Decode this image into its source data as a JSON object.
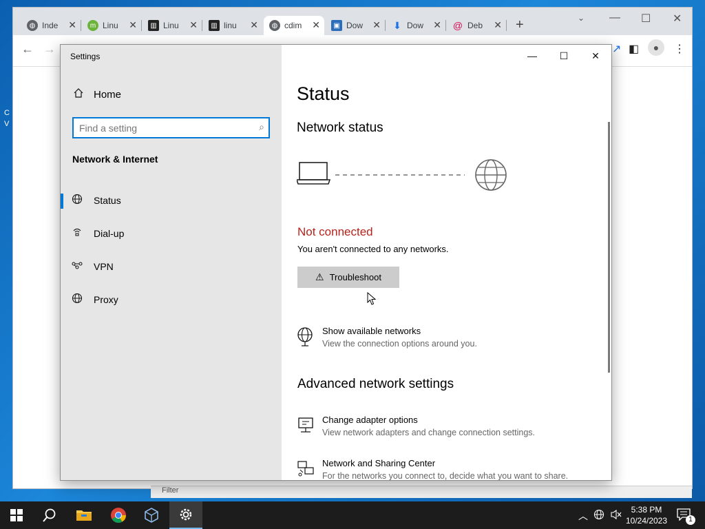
{
  "browser": {
    "tabs": [
      {
        "label": "Inde",
        "favicon": "globe-icon",
        "color": "#5f6368"
      },
      {
        "label": "Linu",
        "favicon": "mint-icon",
        "color": "#6bb33b"
      },
      {
        "label": "Linu",
        "favicon": "archive-icon",
        "color": "#222222"
      },
      {
        "label": "linu",
        "favicon": "archive-icon",
        "color": "#222222"
      },
      {
        "label": "cdim",
        "favicon": "globe-icon",
        "color": "#5f6368"
      },
      {
        "label": "Dow",
        "favicon": "image-icon",
        "color": "#2a6ebb"
      },
      {
        "label": "Dow",
        "favicon": "download-icon",
        "color": "#1a73e8"
      },
      {
        "label": "Deb",
        "favicon": "debian-icon",
        "color": "#d70a53"
      }
    ],
    "bottom_bar_text": "Filter"
  },
  "settings": {
    "window_title": "Settings",
    "nav": {
      "home_label": "Home",
      "search_placeholder": "Find a setting",
      "section_title": "Network & Internet",
      "items": [
        {
          "label": "Status",
          "icon": "status-globe-icon",
          "selected": true
        },
        {
          "label": "Dial-up",
          "icon": "dialup-icon",
          "selected": false
        },
        {
          "label": "VPN",
          "icon": "vpn-icon",
          "selected": false
        },
        {
          "label": "Proxy",
          "icon": "globe-icon",
          "selected": false
        }
      ]
    },
    "content": {
      "title": "Status",
      "network_status_title": "Network status",
      "not_connected": "Not connected",
      "not_connected_desc": "You aren't connected to any networks.",
      "troubleshoot_label": "Troubleshoot",
      "show_networks": {
        "title": "Show available networks",
        "desc": "View the connection options around you."
      },
      "advanced_title": "Advanced network settings",
      "change_adapter": {
        "title": "Change adapter options",
        "desc": "View network adapters and change connection settings."
      },
      "sharing_center": {
        "title": "Network and Sharing Center",
        "desc": "For the networks you connect to, decide what you want to share."
      }
    }
  },
  "taskbar": {
    "time": "5:38 PM",
    "date": "10/24/2023",
    "notification_count": "1"
  },
  "colors": {
    "accent": "#0078d7",
    "error": "#b5231b"
  }
}
